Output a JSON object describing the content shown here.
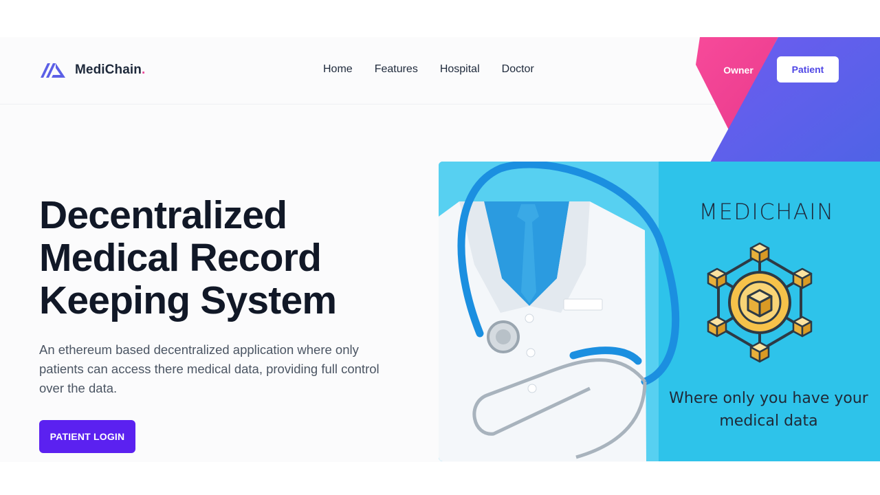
{
  "brand": {
    "name": "MediChain",
    "dot": "."
  },
  "nav": {
    "items": [
      {
        "label": "Home"
      },
      {
        "label": "Features"
      },
      {
        "label": "Hospital"
      },
      {
        "label": "Doctor"
      }
    ]
  },
  "header_actions": {
    "owner_label": "Owner",
    "patient_label": "Patient"
  },
  "hero": {
    "title_line1": "Decentralized",
    "title_line2": "Medical Record",
    "title_line3": "Keeping System",
    "description": "An ethereum based decentralized application where only patients can access there medical data, providing full control over the data.",
    "cta_label": "PATIENT LOGIN"
  },
  "hero_image": {
    "title": "MEDICHAIN",
    "caption_line1": "Where only you have your",
    "caption_line2": "medical data"
  },
  "colors": {
    "accent": "#5b21f0",
    "brand_pink": "#ec4899",
    "deco_pink": "#f0459a",
    "deco_indigo": "#5d5fe8",
    "image_bg": "#2fc2ea"
  }
}
